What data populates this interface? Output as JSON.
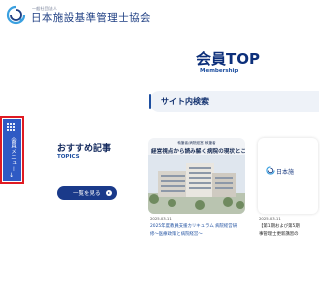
{
  "header": {
    "org_small": "一般社団法人",
    "org_name": "日本施設基準管理士協会"
  },
  "hero": {
    "title": "会員TOP",
    "subtitle": "Membership"
  },
  "search": {
    "label": "サイト内検索"
  },
  "side_tab": {
    "label": "会員メニュー",
    "arrow": "↓"
  },
  "recommended": {
    "title": "おすすめ記事",
    "subtitle": "TOPICS",
    "button_label": "一覧を見る"
  },
  "articles": [
    {
      "image_caption": "執筆者/病院経営 執筆者",
      "image_headline": "経営視点から読み解く病院の現状とこれから",
      "date": "2025.03.11",
      "title_line1": "2025年度教員支援カリキュラム 病院経営研",
      "title_line2": "修～医療政策と病院経営～"
    },
    {
      "image_text": "日本施",
      "date": "2025.03.11",
      "title_line1": "【第1期および第5期",
      "title_line2": "事管理士更新講習の"
    }
  ],
  "colors": {
    "brand_navy": "#1a3a8a",
    "tab_blue": "#2f5ac4",
    "highlight_red": "#e01b22"
  }
}
